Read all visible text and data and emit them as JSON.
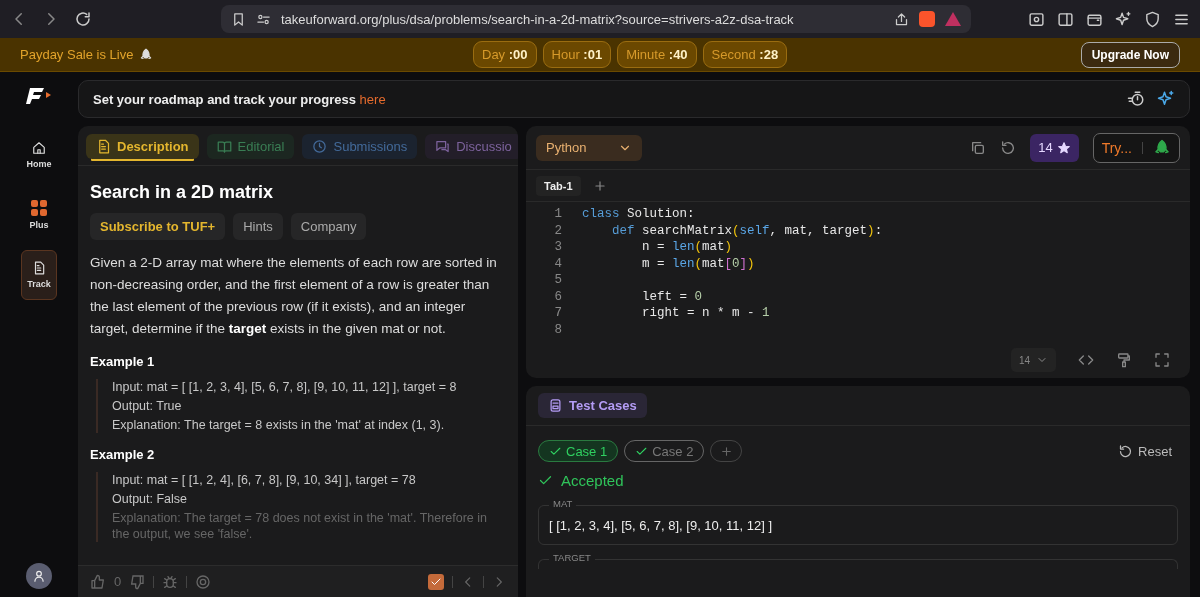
{
  "browser": {
    "url": "takeuforward.org/plus/dsa/problems/search-in-a-2d-matrix?source=strivers-a2z-dsa-track"
  },
  "promo": {
    "text": "Payday Sale is Live",
    "timer": [
      {
        "label": "Day",
        "value": ":00"
      },
      {
        "label": "Hour",
        "value": ":01"
      },
      {
        "label": "Minute",
        "value": ":40"
      },
      {
        "label": "Second",
        "value": ":28"
      }
    ],
    "upgrade": "Upgrade Now"
  },
  "sidebar": {
    "items": [
      {
        "label": "Home",
        "kind": "home",
        "selected": false
      },
      {
        "label": "Plus",
        "kind": "plus",
        "selected": false
      },
      {
        "label": "Track",
        "kind": "track",
        "selected": true
      }
    ]
  },
  "banner": {
    "text": "Set your roadmap and track your progress",
    "link": "here"
  },
  "problem": {
    "tabs": [
      {
        "label": "Description",
        "kind": "doc",
        "selected": true
      },
      {
        "label": "Editorial",
        "kind": "book",
        "selected": false
      },
      {
        "label": "Submissions",
        "kind": "clock",
        "selected": false
      },
      {
        "label": "Discussio",
        "kind": "chat",
        "selected": false
      }
    ],
    "title": "Search in a 2D matrix",
    "chips": [
      {
        "label": "Subscribe to TUF+",
        "kind": "premium"
      },
      {
        "label": "Hints",
        "kind": "plain"
      },
      {
        "label": "Company",
        "kind": "plain"
      }
    ],
    "description": "Given a 2-D array mat where the elements of each row are sorted in non-decreasing order, and the first element of a row is greater than the last element of the previous row (if it exists), and an integer target, determine if the **target** exists in the given mat or not.",
    "examples": [
      {
        "title": "Example 1",
        "lines": [
          "Input: mat = [ [1, 2, 3, 4], [5, 6, 7, 8], [9, 10, 11, 12] ], target = 8",
          "Output: True",
          "Explanation: The target = 8 exists in the 'mat' at index (1, 3)."
        ]
      },
      {
        "title": "Example 2",
        "lines": [
          "Input: mat = [ [1, 2, 4], [6, 7, 8], [9, 10, 34] ], target = 78",
          "Output: False",
          "Explanation: The target = 78 does not exist in the 'mat'. Therefore in the output, we see 'false'."
        ]
      }
    ],
    "footer": {
      "likes": "0",
      "solved": true
    }
  },
  "editor": {
    "language": "Python",
    "stars": "14",
    "try": "Try...",
    "tabs": [
      {
        "label": "Tab-1",
        "selected": true
      }
    ],
    "lines": [
      {
        "num": "1",
        "tokens": [
          {
            "text": "class",
            "kind": "keyword"
          },
          {
            "text": " Solution:",
            "kind": "plain"
          }
        ]
      },
      {
        "num": "2",
        "tokens": [
          {
            "text": "    def",
            "kind": "keyword"
          },
          {
            "text": " searchMatrix",
            "kind": "plain"
          },
          {
            "text": "(",
            "kind": "paren"
          },
          {
            "text": "self",
            "kind": "builtin"
          },
          {
            "text": ", mat, target",
            "kind": "plain"
          },
          {
            "text": ")",
            "kind": "paren"
          },
          {
            "text": ":",
            "kind": "plain"
          }
        ]
      },
      {
        "num": "3",
        "tokens": [
          {
            "text": "        n = ",
            "kind": "plain"
          },
          {
            "text": "len",
            "kind": "builtin"
          },
          {
            "text": "(",
            "kind": "paren"
          },
          {
            "text": "mat",
            "kind": "plain"
          },
          {
            "text": ")",
            "kind": "paren"
          }
        ]
      },
      {
        "num": "4",
        "tokens": [
          {
            "text": "        m = ",
            "kind": "plain"
          },
          {
            "text": "len",
            "kind": "builtin"
          },
          {
            "text": "(",
            "kind": "paren"
          },
          {
            "text": "mat",
            "kind": "plain"
          },
          {
            "text": "[",
            "kind": "bracket"
          },
          {
            "text": "0",
            "kind": "number"
          },
          {
            "text": "]",
            "kind": "bracket"
          },
          {
            "text": ")",
            "kind": "paren"
          }
        ]
      },
      {
        "num": "5"
      },
      {
        "num": "6",
        "tokens": [
          {
            "text": "        left = ",
            "kind": "plain"
          },
          {
            "text": "0",
            "kind": "number"
          }
        ]
      },
      {
        "num": "7",
        "tokens": [
          {
            "text": "        right = n * m - ",
            "kind": "plain"
          },
          {
            "text": "1",
            "kind": "number"
          }
        ]
      },
      {
        "num": "8"
      }
    ],
    "font_size": "14"
  },
  "tests": {
    "title": "Test Cases",
    "cases": [
      {
        "label": "Case 1",
        "selected": true
      },
      {
        "label": "Case 2",
        "selected": false
      }
    ],
    "reset": "Reset",
    "status": "Accepted",
    "fields": [
      {
        "label": "MAT",
        "value": "[ [1, 2, 3, 4], [5, 6, 7, 8], [9, 10, 11, 12] ]"
      },
      {
        "label": "TARGET"
      }
    ]
  }
}
